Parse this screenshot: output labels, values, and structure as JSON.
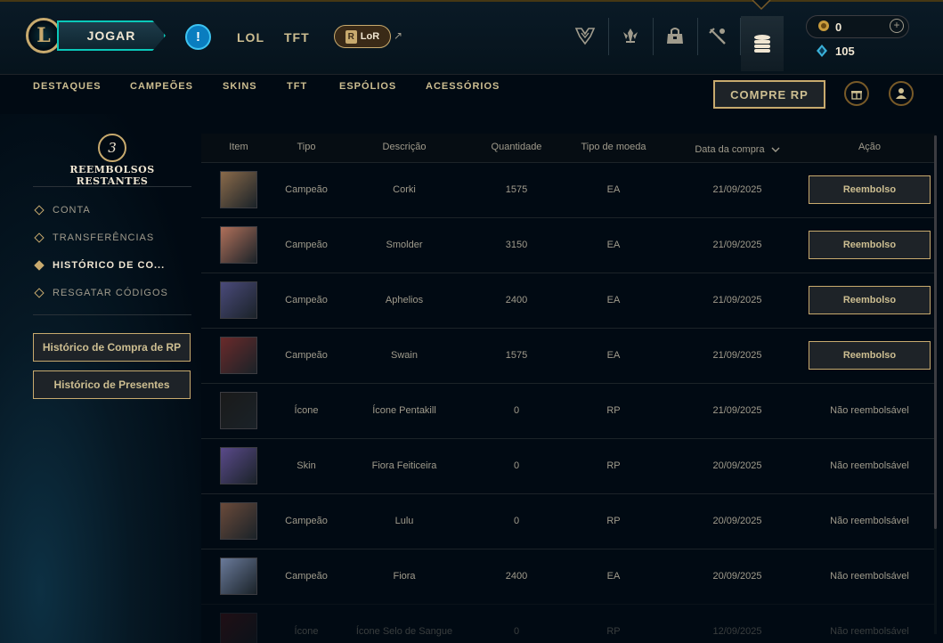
{
  "topbar": {
    "play_label": "JOGAR",
    "alert_label": "!",
    "links": [
      "LOL",
      "TFT"
    ],
    "lor_label": "LoR",
    "lor_badge": "R",
    "ext_glyph": "↗",
    "nav_icons": [
      "trophy-icon",
      "clash-icon",
      "inventory-icon",
      "crafting-icon",
      "store-icon"
    ],
    "active_nav": "store-icon",
    "rp_amount": "0",
    "be_amount": "105",
    "plus_glyph": "+"
  },
  "subnav": {
    "items": [
      "DESTAQUES",
      "CAMPEÕES",
      "SKINS",
      "TFT",
      "ESPÓLIOS",
      "ACESSÓRIOS"
    ],
    "buy_rp_label": "COMPRE RP"
  },
  "sidebar": {
    "refunds_count": "3",
    "refunds_label": "REEMBOLSOS RESTANTES",
    "items": [
      {
        "label": "CONTA",
        "active": false
      },
      {
        "label": "TRANSFERÊNCIAS",
        "active": false
      },
      {
        "label": "HISTÓRICO DE CO...",
        "active": true
      },
      {
        "label": "RESGATAR CÓDIGOS",
        "active": false
      }
    ],
    "buttons": [
      "Histórico de Compra de RP",
      "Histórico de Presentes"
    ]
  },
  "table": {
    "headers": {
      "item": "Item",
      "type": "Tipo",
      "description": "Descrição",
      "quantity": "Quantidade",
      "currency": "Tipo de moeda",
      "date": "Data da compra",
      "action": "Ação"
    },
    "refund_label": "Reembolso",
    "non_refundable_label": "Não reembolsável",
    "rows": [
      {
        "type": "Campeão",
        "description": "Corki",
        "quantity": "1575",
        "currency": "EA",
        "date": "21/09/2025",
        "refundable": true,
        "thumb_color": "#8a6a4a"
      },
      {
        "type": "Campeão",
        "description": "Smolder",
        "quantity": "3150",
        "currency": "EA",
        "date": "21/09/2025",
        "refundable": true,
        "thumb_color": "#b0705a"
      },
      {
        "type": "Campeão",
        "description": "Aphelios",
        "quantity": "2400",
        "currency": "EA",
        "date": "21/09/2025",
        "refundable": true,
        "thumb_color": "#4a4a7a"
      },
      {
        "type": "Campeão",
        "description": "Swain",
        "quantity": "1575",
        "currency": "EA",
        "date": "21/09/2025",
        "refundable": true,
        "thumb_color": "#6a2a2a"
      },
      {
        "type": "Ícone",
        "description": "Ícone Pentakill",
        "quantity": "0",
        "currency": "RP",
        "date": "21/09/2025",
        "refundable": false,
        "thumb_color": "#1a1a1a"
      },
      {
        "type": "Skin",
        "description": "Fiora Feiticeira",
        "quantity": "0",
        "currency": "RP",
        "date": "20/09/2025",
        "refundable": false,
        "thumb_color": "#5a4a8a"
      },
      {
        "type": "Campeão",
        "description": "Lulu",
        "quantity": "0",
        "currency": "RP",
        "date": "20/09/2025",
        "refundable": false,
        "thumb_color": "#6a4a3a"
      },
      {
        "type": "Campeão",
        "description": "Fiora",
        "quantity": "2400",
        "currency": "EA",
        "date": "20/09/2025",
        "refundable": false,
        "thumb_color": "#6a7a9a"
      },
      {
        "type": "Ícone",
        "description": "Ícone Selo de Sangue",
        "quantity": "0",
        "currency": "RP",
        "date": "12/09/2025",
        "refundable": false,
        "thumb_color": "#5a1a1a"
      }
    ]
  }
}
